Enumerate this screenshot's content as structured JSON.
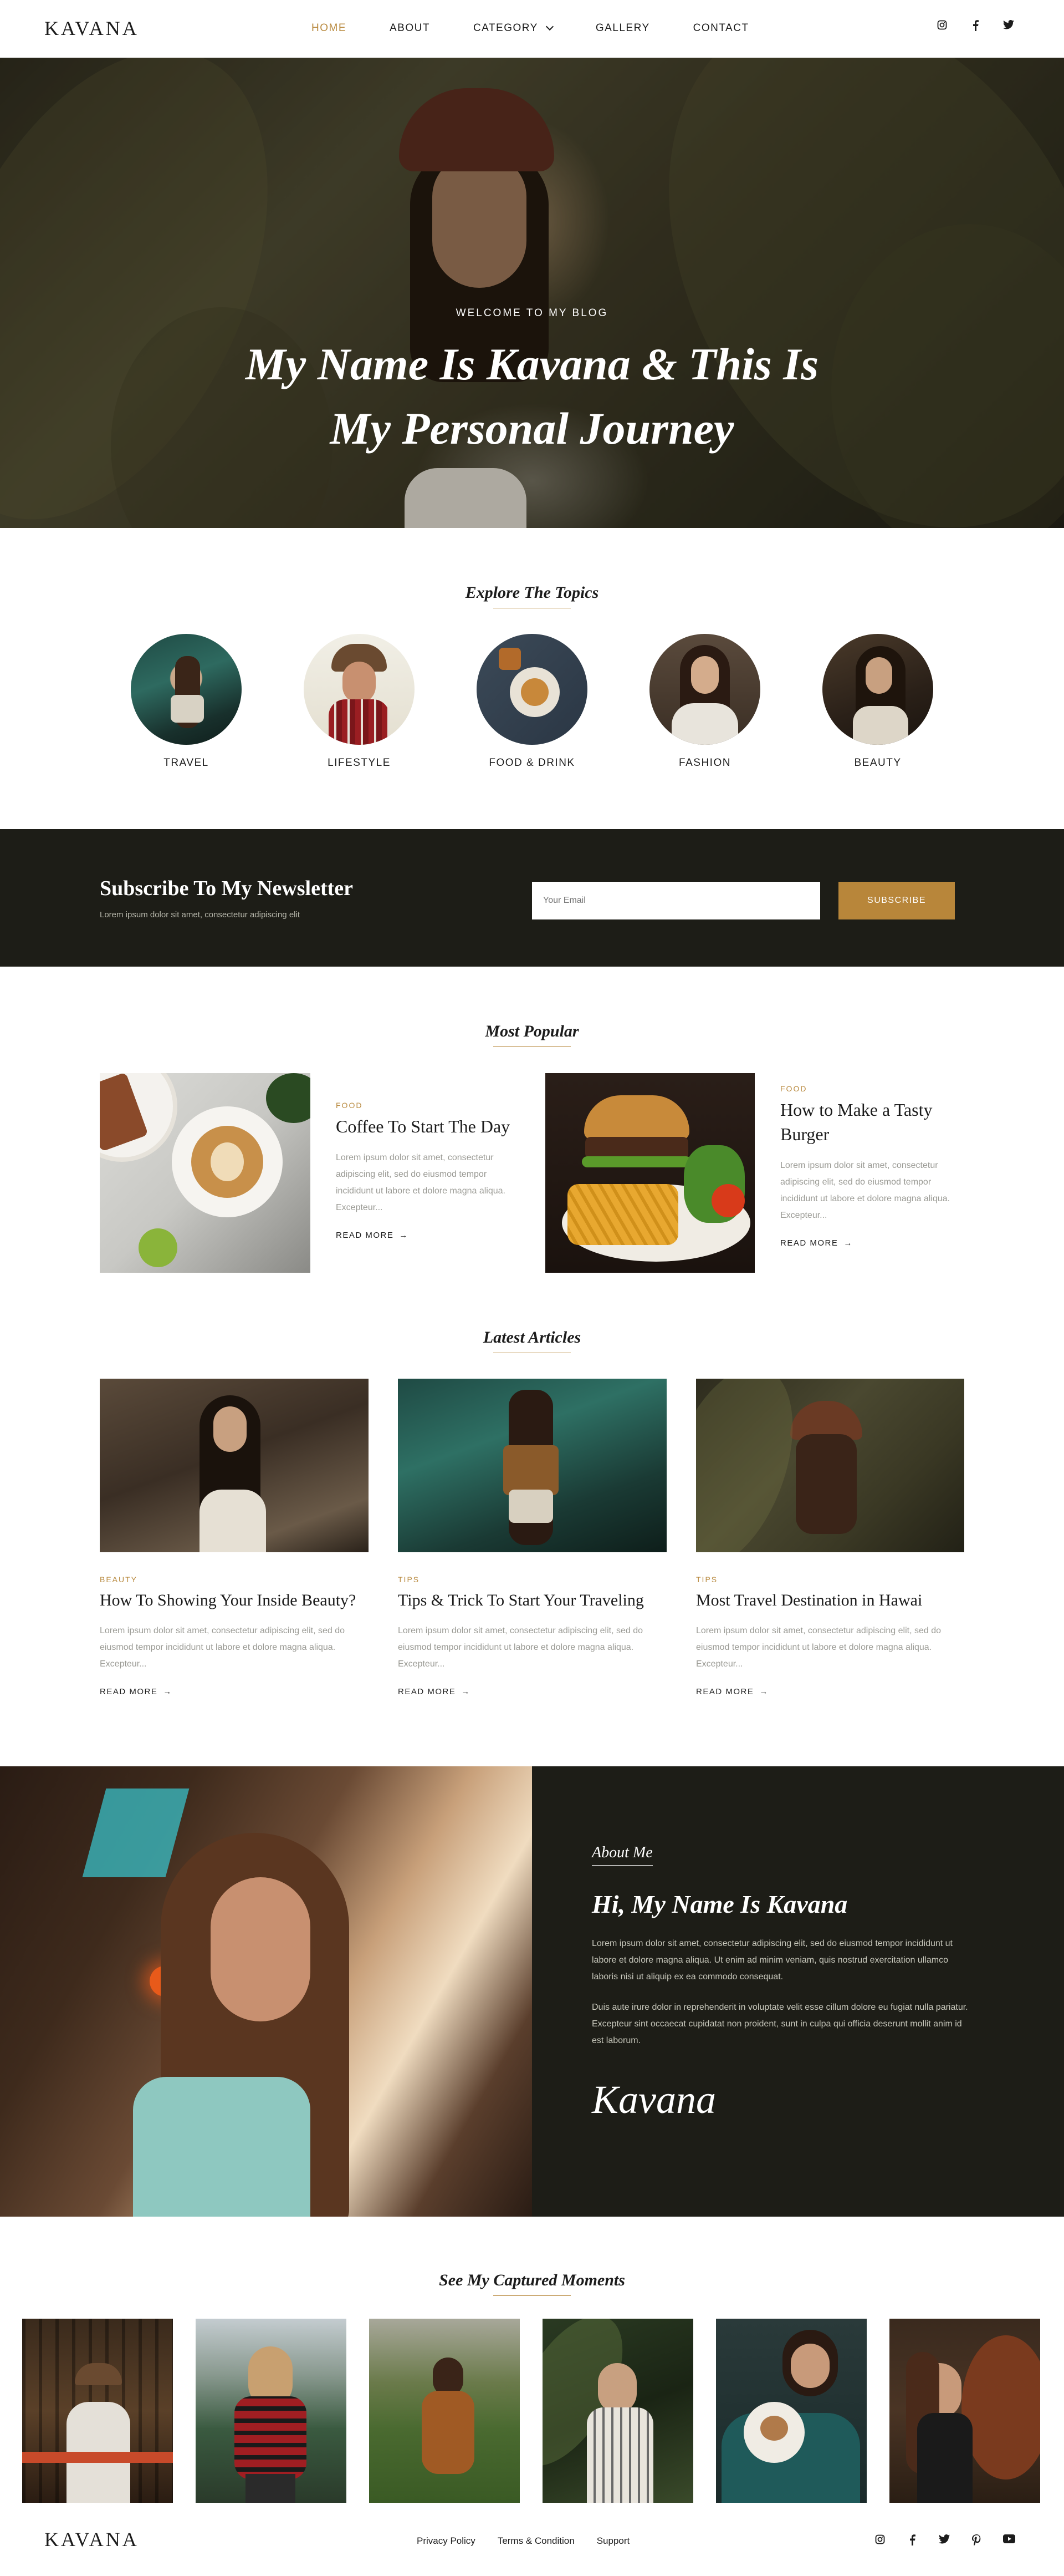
{
  "header": {
    "logo": "KAVANA",
    "nav": [
      {
        "label": "HOME",
        "active": true
      },
      {
        "label": "ABOUT"
      },
      {
        "label": "CATEGORY",
        "dropdown": true
      },
      {
        "label": "GALLERY"
      },
      {
        "label": "CONTACT"
      }
    ],
    "social": [
      "instagram-icon",
      "facebook-icon",
      "twitter-icon"
    ]
  },
  "hero": {
    "kicker": "WELCOME TO MY BLOG",
    "title_line1": "My Name Is Kavana & This Is",
    "title_line2": "My Personal Journey"
  },
  "topics": {
    "title": "Explore The Topics",
    "items": [
      {
        "label": "TRAVEL"
      },
      {
        "label": "LIFESTYLE"
      },
      {
        "label": "FOOD & DRINK"
      },
      {
        "label": "FASHION"
      },
      {
        "label": "BEAUTY"
      }
    ]
  },
  "newsletter": {
    "title": "Subscribe To My Newsletter",
    "subtitle": "Lorem ipsum dolor sit amet, consectetur adipiscing elit",
    "placeholder": "Your Email",
    "button": "SUBSCRIBE"
  },
  "popular": {
    "title": "Most Popular",
    "posts": [
      {
        "category": "FOOD",
        "title": "Coffee To Start The Day",
        "excerpt": "Lorem ipsum dolor sit amet, consectetur adipiscing elit, sed do eiusmod tempor incididunt ut labore et dolore magna aliqua. Excepteur...",
        "read_more": "READ MORE"
      },
      {
        "category": "FOOD",
        "title": "How to Make a Tasty Burger",
        "excerpt": "Lorem ipsum dolor sit amet, consectetur adipiscing elit, sed do eiusmod tempor incididunt ut labore et dolore magna aliqua. Excepteur...",
        "read_more": "READ MORE"
      }
    ]
  },
  "latest": {
    "title": "Latest Articles",
    "posts": [
      {
        "category": "BEAUTY",
        "title": "How To Showing Your Inside Beauty?",
        "excerpt": "Lorem ipsum dolor sit amet, consectetur adipiscing elit, sed do eiusmod tempor incididunt ut labore et dolore magna aliqua. Excepteur...",
        "read_more": "READ MORE"
      },
      {
        "category": "TIPS",
        "title": "Tips & Trick To Start Your Traveling",
        "excerpt": "Lorem ipsum dolor sit amet, consectetur adipiscing elit, sed do eiusmod tempor incididunt ut labore et dolore magna aliqua. Excepteur...",
        "read_more": "READ MORE"
      },
      {
        "category": "TIPS",
        "title": "Most Travel Destination in Hawai",
        "excerpt": "Lorem ipsum dolor sit amet, consectetur adipiscing elit, sed do eiusmod tempor incididunt ut labore et dolore magna aliqua. Excepteur...",
        "read_more": "READ MORE"
      }
    ]
  },
  "about": {
    "kicker": "About Me",
    "title": "Hi, My Name Is Kavana",
    "p1": "Lorem ipsum dolor sit amet, consectetur adipiscing elit, sed do eiusmod tempor incididunt ut labore et dolore magna aliqua. Ut enim ad minim veniam, quis nostrud exercitation ullamco laboris nisi ut aliquip ex ea commodo consequat.",
    "p2": "Duis aute irure dolor in reprehenderit in voluptate velit esse cillum dolore eu fugiat nulla pariatur. Excepteur sint occaecat cupidatat non proident, sunt in culpa qui officia deserunt mollit anim id est laborum.",
    "signature": "Kavana"
  },
  "gallery": {
    "title": "See My Captured Moments"
  },
  "footer": {
    "logo": "KAVANA",
    "links": [
      "Privacy Policy",
      "Terms & Condition",
      "Support"
    ],
    "social": [
      "instagram-icon",
      "facebook-icon",
      "twitter-icon",
      "pinterest-icon",
      "youtube-icon"
    ]
  },
  "colors": {
    "accent": "#b8893e",
    "dark": "#1d1d17",
    "text": "#1c1c1c",
    "muted": "#9a9a94"
  }
}
